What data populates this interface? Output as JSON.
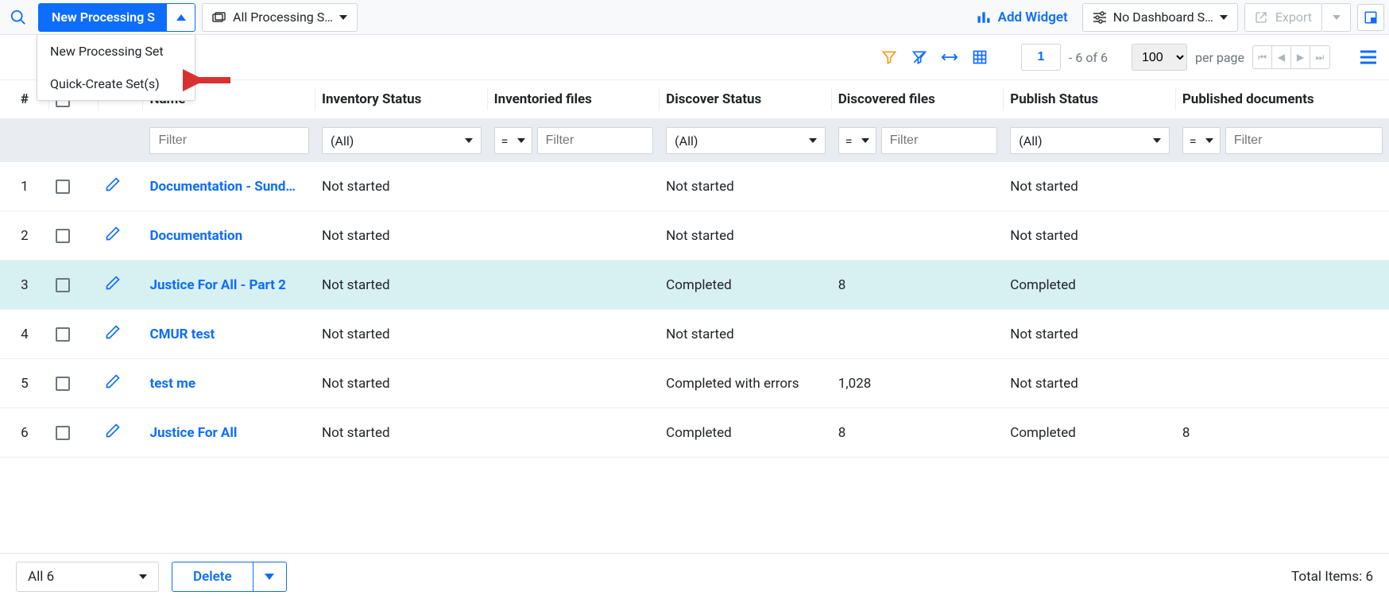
{
  "toolbar": {
    "new_btn": "New Processing S",
    "view_select": "All Processing S…",
    "add_widget": "Add Widget",
    "dashboard_select": "No Dashboard S…",
    "export": "Export",
    "dropdown": {
      "item1": "New Processing Set",
      "item2": "Quick-Create Set(s)"
    }
  },
  "gridbar": {
    "page_value": "1",
    "range": "- 6  of  6",
    "page_size": "100",
    "per_page": "per page"
  },
  "columns": {
    "num": "#",
    "name": "Name",
    "inv": "Inventory Status",
    "invf": "Inventoried files",
    "disc": "Discover Status",
    "discf": "Discovered files",
    "pub": "Publish Status",
    "pubd": "Published documents"
  },
  "filters": {
    "placeholder": "Filter",
    "all": "(All)",
    "eq": "="
  },
  "rows": [
    {
      "n": "1",
      "name": "Documentation - Sund…",
      "inv": "Not started",
      "invf": "",
      "disc": "Not started",
      "discf": "",
      "pub": "Not started",
      "pubd": "",
      "hl": false
    },
    {
      "n": "2",
      "name": "Documentation",
      "inv": "Not started",
      "invf": "",
      "disc": "Not started",
      "discf": "",
      "pub": "Not started",
      "pubd": "",
      "hl": false
    },
    {
      "n": "3",
      "name": "Justice For All - Part 2",
      "inv": "Not started",
      "invf": "",
      "disc": "Completed",
      "discf": "8",
      "pub": "Completed",
      "pubd": "",
      "hl": true
    },
    {
      "n": "4",
      "name": "CMUR test",
      "inv": "Not started",
      "invf": "",
      "disc": "Not started",
      "discf": "",
      "pub": "Not started",
      "pubd": "",
      "hl": false
    },
    {
      "n": "5",
      "name": "test me",
      "inv": "Not started",
      "invf": "",
      "disc": "Completed with errors",
      "discf": "1,028",
      "pub": "Not started",
      "pubd": "",
      "hl": false
    },
    {
      "n": "6",
      "name": "Justice For All",
      "inv": "Not started",
      "invf": "",
      "disc": "Completed",
      "discf": "8",
      "pub": "Completed",
      "pubd": "8",
      "hl": false
    }
  ],
  "footer": {
    "selection": "All 6",
    "action": "Delete",
    "total": "Total Items: 6"
  }
}
